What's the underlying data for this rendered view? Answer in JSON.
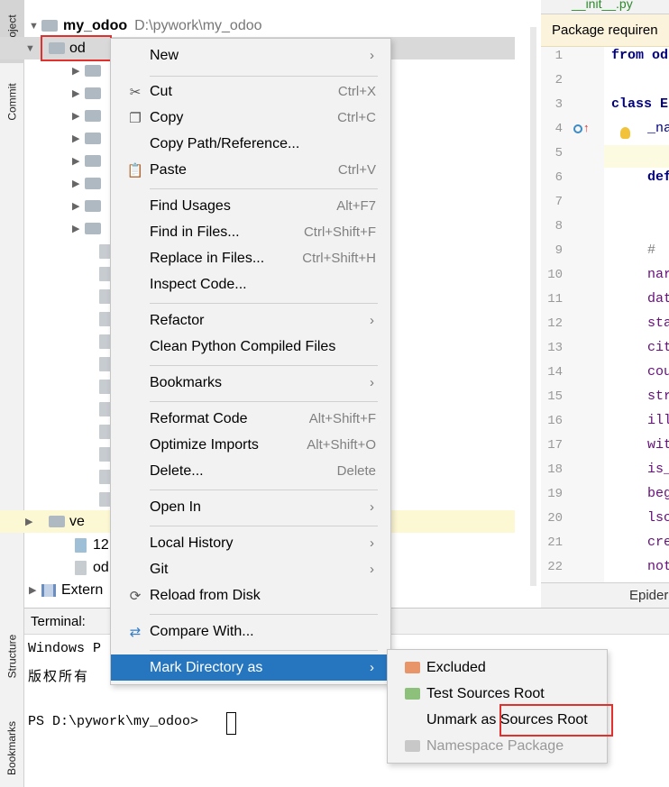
{
  "left_strip": {
    "project": "Project",
    "commit": "Commit",
    "structure": "Structure",
    "bookmarks": "Bookmarks"
  },
  "project_tree": {
    "root_name": "my_odoo",
    "root_path": "D:\\pywork\\my_odoo",
    "selected_name": "od",
    "venv_name": "ve",
    "row_12": "12",
    "row_od": "od",
    "external": "Extern"
  },
  "editor": {
    "tab": "__init__.py",
    "banner": "Package requiren",
    "lines": [
      {
        "n": "1",
        "text": "from od"
      },
      {
        "n": "2",
        "text": ""
      },
      {
        "n": "3",
        "text": "class E"
      },
      {
        "n": "4",
        "text": "_na"
      },
      {
        "n": "5",
        "text": ""
      },
      {
        "n": "6",
        "text": "def"
      },
      {
        "n": "7",
        "text": ""
      },
      {
        "n": "8",
        "text": ""
      },
      {
        "n": "9",
        "text": "# "
      },
      {
        "n": "10",
        "text": "nar"
      },
      {
        "n": "11",
        "text": "dat"
      },
      {
        "n": "12",
        "text": "sta"
      },
      {
        "n": "13",
        "text": "cit"
      },
      {
        "n": "14",
        "text": "cou"
      },
      {
        "n": "15",
        "text": "str"
      },
      {
        "n": "16",
        "text": "ill"
      },
      {
        "n": "17",
        "text": "wit"
      },
      {
        "n": "18",
        "text": "is_"
      },
      {
        "n": "19",
        "text": "beg"
      },
      {
        "n": "20",
        "text": "lsc"
      },
      {
        "n": "21",
        "text": "cre"
      },
      {
        "n": "22",
        "text": "not"
      }
    ],
    "bottom_label": "Epider"
  },
  "terminal": {
    "title": "Terminal:",
    "line1": "Windows P",
    "line2": "版权所有",
    "prompt": "PS D:\\pywork\\my_odoo>"
  },
  "context_menu": {
    "new": "New",
    "cut": "Cut",
    "cut_sc": "Ctrl+X",
    "copy": "Copy",
    "copy_sc": "Ctrl+C",
    "copy_path": "Copy Path/Reference...",
    "paste": "Paste",
    "paste_sc": "Ctrl+V",
    "find_usages": "Find Usages",
    "find_usages_sc": "Alt+F7",
    "find_in_files": "Find in Files...",
    "find_in_files_sc": "Ctrl+Shift+F",
    "replace_in_files": "Replace in Files...",
    "replace_in_files_sc": "Ctrl+Shift+H",
    "inspect_code": "Inspect Code...",
    "refactor": "Refactor",
    "clean_python": "Clean Python Compiled Files",
    "bookmarks": "Bookmarks",
    "reformat_code": "Reformat Code",
    "reformat_code_sc": "Alt+Shift+F",
    "optimize_imports": "Optimize Imports",
    "optimize_imports_sc": "Alt+Shift+O",
    "delete": "Delete...",
    "delete_sc": "Delete",
    "open_in": "Open In",
    "local_history": "Local History",
    "git": "Git",
    "reload_from_disk": "Reload from Disk",
    "compare_with": "Compare With...",
    "mark_directory_as": "Mark Directory as"
  },
  "submenu": {
    "excluded": "Excluded",
    "test_sources_root": "Test Sources Root",
    "unmark_as": "Unmark as",
    "sources_root": "Sources Root",
    "namespace_package": "Namespace Package"
  },
  "colors": {
    "menu_active": "#2675bf",
    "highlight_box": "#e0312f",
    "excluded_icon": "#e8956a",
    "test_sources_icon": "#8dc07a"
  }
}
